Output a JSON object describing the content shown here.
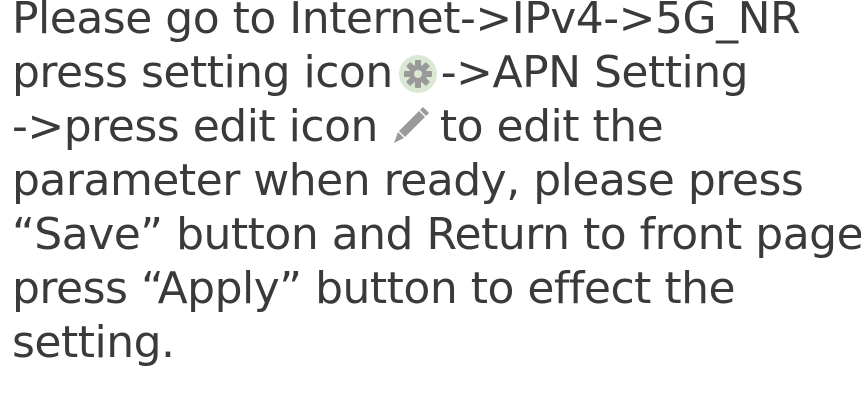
{
  "instruction": {
    "line1": "Please go to Internet->IPv4->5G_NR",
    "line2_before": "press setting icon",
    "line2_after": "->APN Setting",
    "line3_before": "->press edit icon",
    "line3_after": "to edit the",
    "line4": "parameter when ready, please press",
    "line5": "“Save” button and Return to front page,",
    "line6": "press “Apply” button to effect the",
    "line7": "setting."
  },
  "icons": {
    "settings": "gear-icon",
    "edit": "pencil-icon"
  },
  "colors": {
    "text": "#3a3a3a",
    "icon": "#9a9a9a",
    "gear_badge": "#d9e7d3"
  }
}
